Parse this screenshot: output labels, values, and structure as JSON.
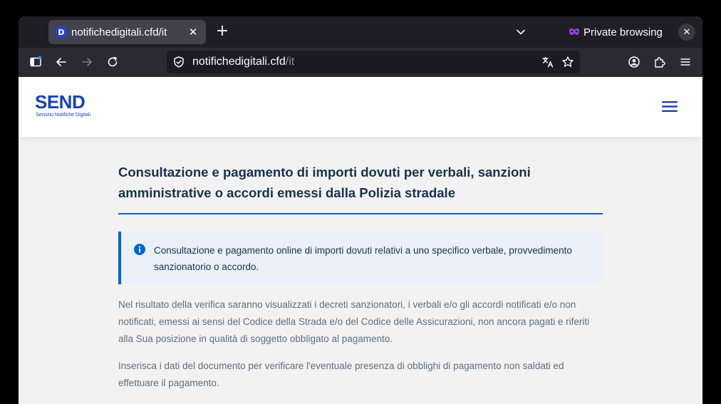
{
  "browser": {
    "tab": {
      "favicon_letter": "D",
      "title": "notifichedigitali.cfd/it",
      "close_glyph": "✕"
    },
    "new_tab_glyph": "+",
    "private_label": "Private browsing",
    "window_close_glyph": "✕",
    "url": {
      "host": "notifichedigitali.cfd",
      "path": "/it"
    },
    "colors": {
      "tabstrip": "#1f1e25",
      "toolbar": "#2b2a33",
      "urlbar": "#1c1b22",
      "private_purple": "#8e46e6"
    }
  },
  "site": {
    "logo": {
      "word": "SEND",
      "subtitle": "Servizio Notifiche Digitali"
    },
    "title": "Consultazione e pagamento di importi dovuti per verbali, sanzioni amministrative o accordi emessi dalla Polizia stradale",
    "callout": "Consultazione e pagamento online di importi dovuti relativi a uno specifico verbale, provvedimento sanzionatorio o accordo.",
    "paragraphs": [
      "Nel risultato della verifica saranno visualizzati i decreti sanzionatori, i verbali e/o gli accordi notificati e/o non notificati, emessi ai sensi del Codice della Strada e/o del Codice delle Assicurazioni, non ancora pagati e riferiti alla Sua posizione in qualità di soggetto obbligato al pagamento.",
      "Inserisca i dati del documento per verificare l'eventuale presenza di obblighi di pagamento non saldati ed effettuare il pagamento."
    ],
    "colors": {
      "brand_blue": "#1642ba",
      "title_navy": "#17324d",
      "rule_blue": "#0d5fb6",
      "callout_bg": "#eaf1fa",
      "body_gray": "#5c6f82"
    }
  }
}
